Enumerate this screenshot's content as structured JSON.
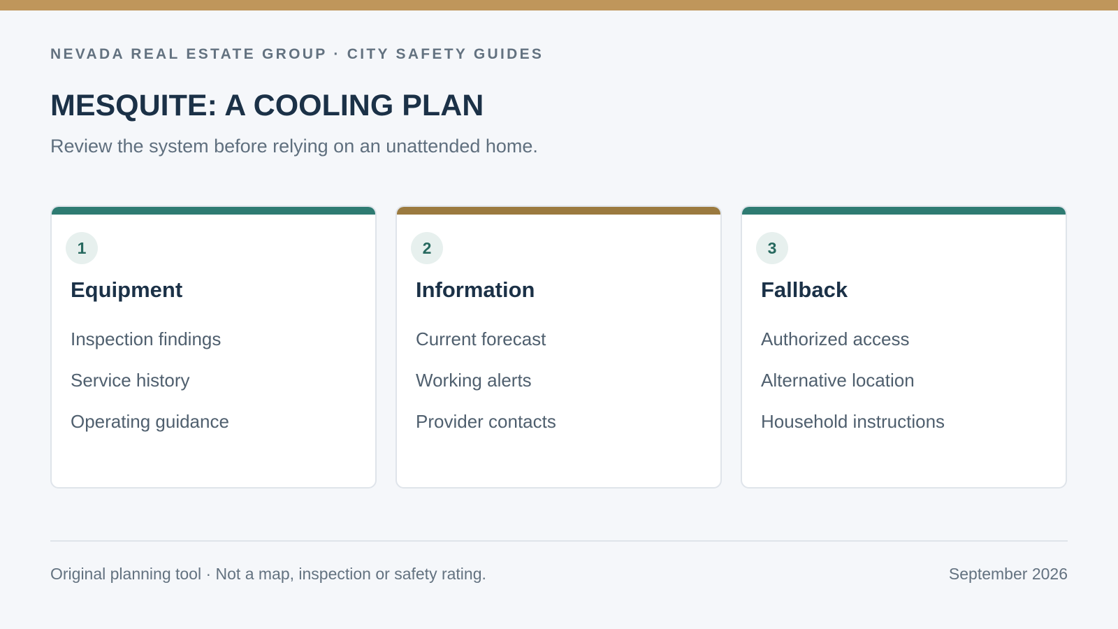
{
  "header": {
    "eyebrow": "NEVADA REAL ESTATE GROUP · CITY SAFETY GUIDES",
    "title": "MESQUITE: A COOLING PLAN",
    "subtitle": "Review the system before relying on an unattended home."
  },
  "cards": [
    {
      "number": "1",
      "title": "Equipment",
      "accent": "#2e7b72",
      "items": [
        "Inspection findings",
        "Service history",
        "Operating guidance"
      ]
    },
    {
      "number": "2",
      "title": "Information",
      "accent": "#9b7a3f",
      "items": [
        "Current forecast",
        "Working alerts",
        "Provider contacts"
      ]
    },
    {
      "number": "3",
      "title": "Fallback",
      "accent": "#2e7b72",
      "items": [
        "Authorized access",
        "Alternative location",
        "Household instructions"
      ]
    }
  ],
  "footer": {
    "note": "Original planning tool · Not a map, inspection or safety rating.",
    "date": "September 2026"
  },
  "colors": {
    "top_bar": "#bf965b",
    "background": "#f5f7fa",
    "heading": "#1b3147"
  }
}
